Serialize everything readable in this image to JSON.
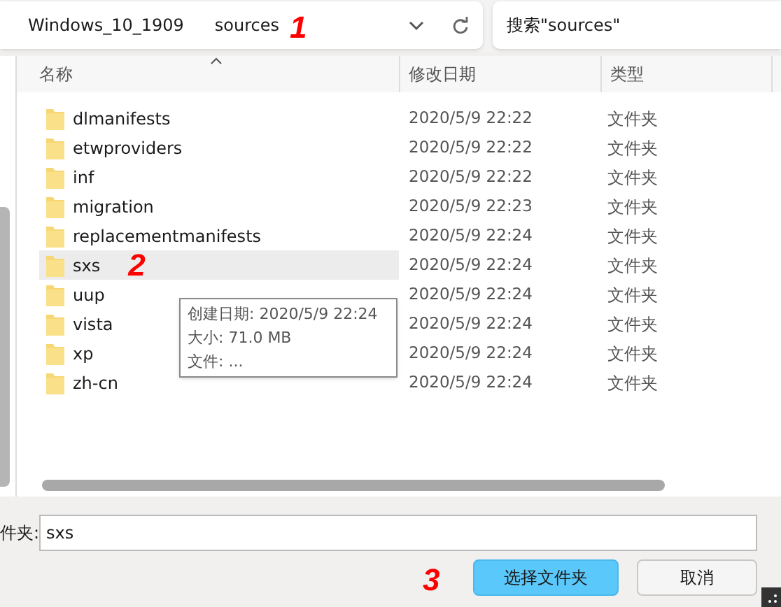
{
  "address_bar": {
    "crumbs": [
      "Windows_10_1909",
      "sources"
    ]
  },
  "search": {
    "placeholder": "搜索\"sources\""
  },
  "table": {
    "columns": [
      "名称",
      "修改日期",
      "类型"
    ],
    "rows": [
      {
        "name": "dlmanifests",
        "date": "2020/5/9 22:22",
        "type": "文件夹",
        "selected": false
      },
      {
        "name": "etwproviders",
        "date": "2020/5/9 22:22",
        "type": "文件夹",
        "selected": false
      },
      {
        "name": "inf",
        "date": "2020/5/9 22:22",
        "type": "文件夹",
        "selected": false
      },
      {
        "name": "migration",
        "date": "2020/5/9 22:23",
        "type": "文件夹",
        "selected": false
      },
      {
        "name": "replacementmanifests",
        "date": "2020/5/9 22:24",
        "type": "文件夹",
        "selected": false
      },
      {
        "name": "sxs",
        "date": "2020/5/9 22:24",
        "type": "文件夹",
        "selected": true
      },
      {
        "name": "uup",
        "date": "2020/5/9 22:24",
        "type": "文件夹",
        "selected": false
      },
      {
        "name": "vista",
        "date": "2020/5/9 22:24",
        "type": "文件夹",
        "selected": false
      },
      {
        "name": "xp",
        "date": "2020/5/9 22:24",
        "type": "文件夹",
        "selected": false
      },
      {
        "name": "zh-cn",
        "date": "2020/5/9 22:24",
        "type": "文件夹",
        "selected": false
      }
    ]
  },
  "tooltip": [
    "创建日期: 2020/5/9 22:24",
    "大小: 71.0 MB",
    "文件: ..."
  ],
  "folder_field": {
    "label": "件夹:",
    "value": "sxs"
  },
  "buttons": [
    {
      "label": "选择文件夹",
      "kind": "primary"
    },
    {
      "label": "取消",
      "kind": "secondary"
    }
  ],
  "annotations": [
    "1",
    "2",
    "3"
  ]
}
